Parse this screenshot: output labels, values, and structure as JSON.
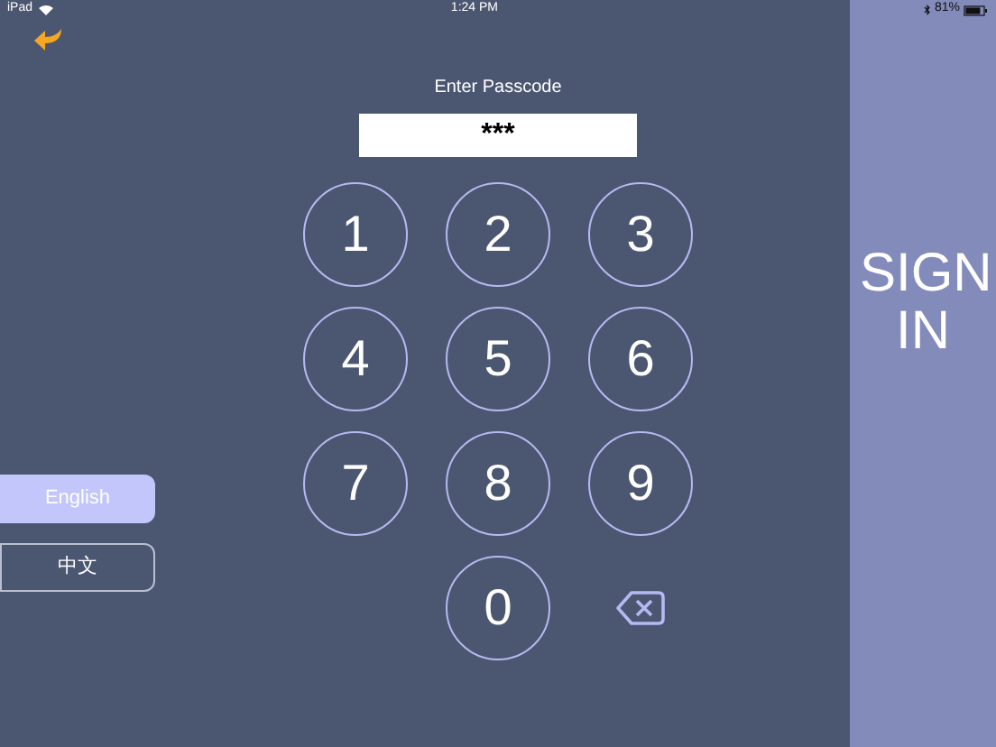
{
  "status_bar": {
    "carrier": "iPad",
    "time": "1:24 PM",
    "battery": "81%"
  },
  "prompt": "Enter Passcode",
  "passcode_field": {
    "value": "***"
  },
  "keypad": [
    {
      "kind": "digit",
      "label": "1"
    },
    {
      "kind": "digit",
      "label": "2"
    },
    {
      "kind": "digit",
      "label": "3"
    },
    {
      "kind": "digit",
      "label": "4"
    },
    {
      "kind": "digit",
      "label": "5"
    },
    {
      "kind": "digit",
      "label": "6"
    },
    {
      "kind": "digit",
      "label": "7"
    },
    {
      "kind": "digit",
      "label": "8"
    },
    {
      "kind": "digit",
      "label": "9"
    },
    {
      "kind": "blank"
    },
    {
      "kind": "digit",
      "label": "0"
    },
    {
      "kind": "delete"
    }
  ],
  "languages": [
    {
      "label": "English",
      "selected": true
    },
    {
      "label": "中文",
      "selected": false
    }
  ],
  "sign_in": "SIGN IN"
}
